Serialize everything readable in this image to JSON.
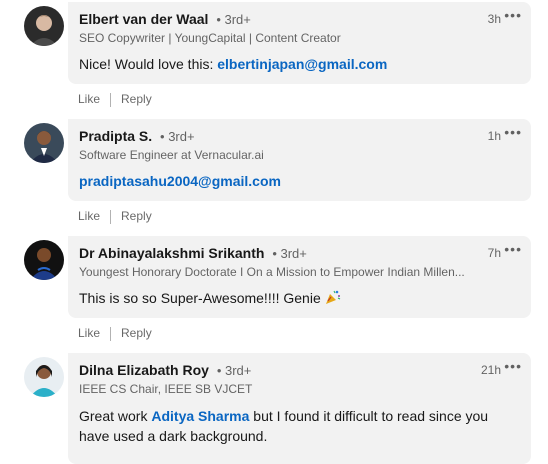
{
  "comments": [
    {
      "name": "Elbert van der Waal",
      "degree": "• 3rd+",
      "headline": "SEO Copywriter | YoungCapital | Content Creator",
      "time": "3h",
      "text_prefix": "Nice! Would love this: ",
      "email": "elbertinjapan@gmail.com",
      "like_label": "Like",
      "reply_label": "Reply"
    },
    {
      "name": "Pradipta S.",
      "degree": "• 3rd+",
      "headline": "Software Engineer at Vernacular.ai",
      "time": "1h",
      "email": "pradiptasahu2004@gmail.com",
      "like_label": "Like",
      "reply_label": "Reply"
    },
    {
      "name": "Dr Abinayalakshmi Srikanth",
      "degree": "• 3rd+",
      "headline": "Youngest Honorary Doctorate I On a Mission to Empower Indian Millen...",
      "time": "7h",
      "text": "This is so so Super-Awesome!!!! Genie",
      "like_label": "Like",
      "reply_label": "Reply"
    },
    {
      "name": "Dilna Elizabath Roy",
      "degree": "• 3rd+",
      "headline": "IEEE CS Chair, IEEE SB VJCET",
      "time": "21h",
      "text_prefix": "Great work ",
      "mention": "Aditya Sharma",
      "text_suffix_line1": " but I found it difficult to read since you",
      "text_line2": "have used a dark background."
    }
  ],
  "more_icon_glyph": "•••"
}
